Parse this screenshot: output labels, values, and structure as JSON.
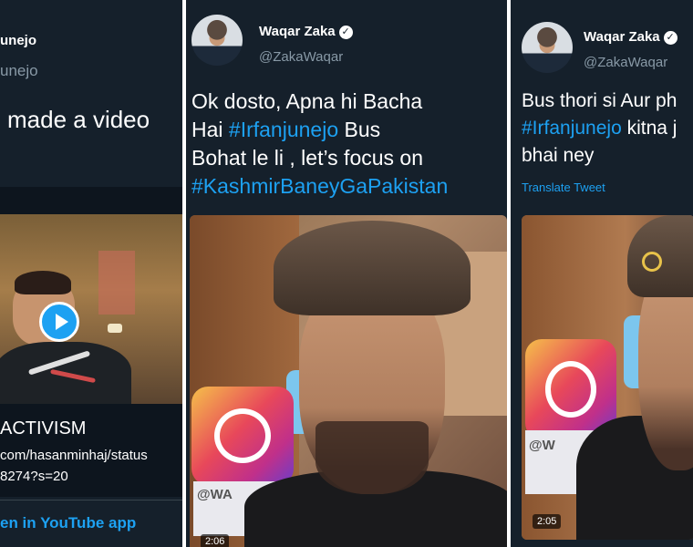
{
  "left_panel": {
    "name_fragment": "unejo",
    "handle_fragment": "unejo",
    "tweet_fragment": "made a video",
    "card_title": "ACTIVISM",
    "card_link_line1": "com/hasanminhaj/status",
    "card_link_line2": "8274?s=20",
    "youtube_link": "en in YouTube app"
  },
  "middle_panel": {
    "name": "Waqar Zaka",
    "handle": "@ZakaWaqar",
    "tweet_line1": "Ok dosto, Apna hi Bacha",
    "tweet_line2_pre": "Hai ",
    "tweet_line2_tag": "#Irfanjunejo",
    "tweet_line2_post": " Bus",
    "tweet_line3": "Bohat le li , let’s focus on",
    "tweet_line4_tag": "#KashmirBaneyGaPakistan",
    "video_duration": "2:06",
    "watermark_fragment": "@WA"
  },
  "right_panel": {
    "name": "Waqar Zaka",
    "handle": "@ZakaWaqar",
    "tweet_line1": "Bus thori si Aur ph",
    "tweet_line2_tag": "#Irfanjunejo",
    "tweet_line2_post": " kitna j",
    "tweet_line3": "bhai ney",
    "translate": "Translate Tweet",
    "video_duration": "2:05",
    "watermark_fragment": "@W"
  },
  "colors": {
    "background": "#15202b",
    "link": "#1da1f2",
    "muted": "#8899a6",
    "play_button": "#1da1f2"
  }
}
